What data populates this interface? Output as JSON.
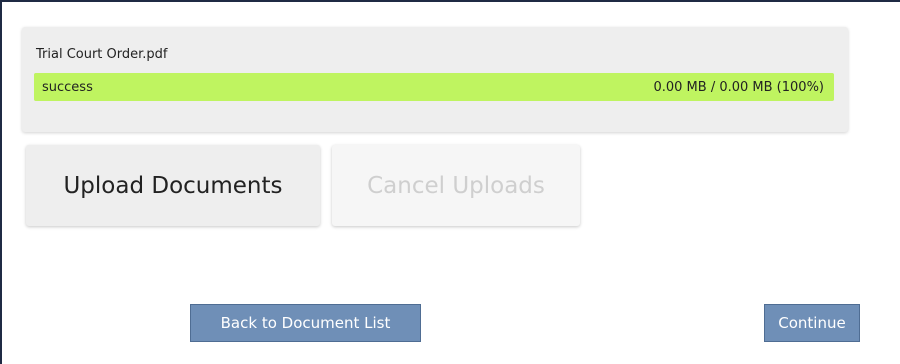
{
  "upload": {
    "file_name": "Trial Court Order.pdf",
    "status": "success",
    "size_text": "0.00 MB / 0.00 MB (100%)",
    "progress_percent": 100,
    "progress_color": "#bff460"
  },
  "actions": {
    "upload_label": "Upload Documents",
    "cancel_label": "Cancel Uploads"
  },
  "navigation": {
    "back_label": "Back to Document List",
    "continue_label": "Continue",
    "button_color": "#6f8fb7"
  }
}
